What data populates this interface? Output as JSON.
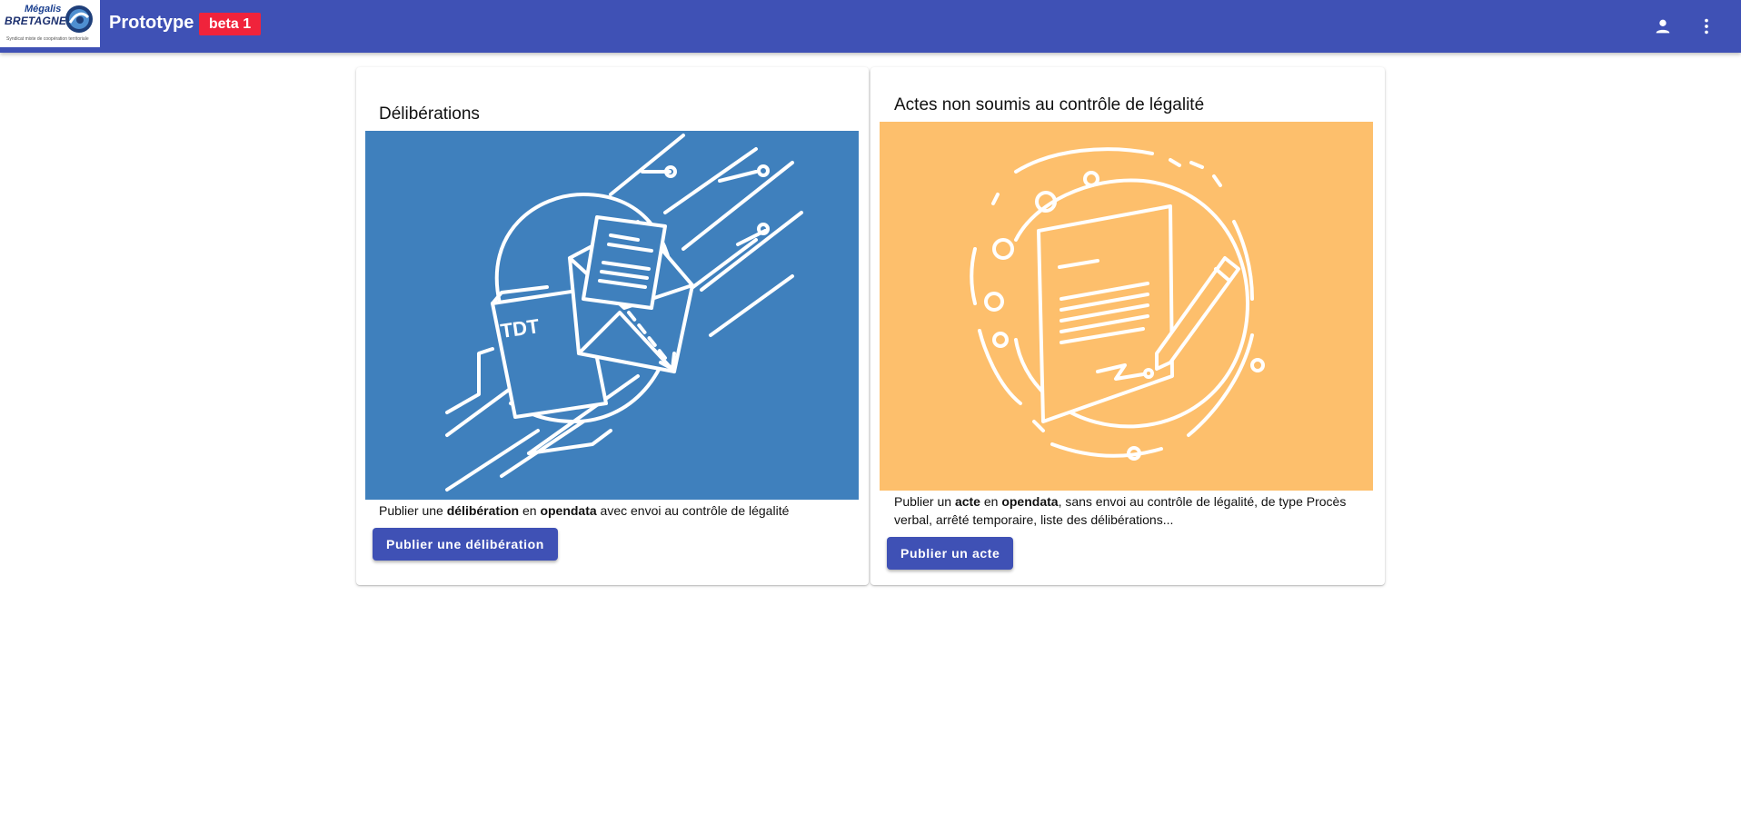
{
  "header": {
    "logo": {
      "top_text": "Mégalis",
      "main_text": "BRETAGNE",
      "sub_text": "Syndicat mixte de coopération territoriale"
    },
    "app_title": "Prototype",
    "badge": "beta 1",
    "icons": [
      "account-icon",
      "more-vert-icon"
    ],
    "colors": {
      "bar": "#3f51b5",
      "badge": "#f0233b"
    }
  },
  "cards": [
    {
      "title": "Délibérations",
      "image_text": "TDT",
      "image_bg": "#3f80bd",
      "description": {
        "p1": "Publier une ",
        "b1": "délibération",
        "p2": " en ",
        "b2": "opendata",
        "p3": " avec envoi au contrôle de légalité"
      },
      "button": "Publier une délibération"
    },
    {
      "title": "Actes non soumis au contrôle de légalité",
      "image_bg": "#fdbf6c",
      "description": {
        "p1": "Publier un ",
        "b1": "acte",
        "p2": " en ",
        "b2": "opendata",
        "p3": ", sans envoi au contrôle de légalité, de type Procès verbal, arrêté temporaire, liste des délibérations..."
      },
      "button": "Publier un acte"
    }
  ]
}
